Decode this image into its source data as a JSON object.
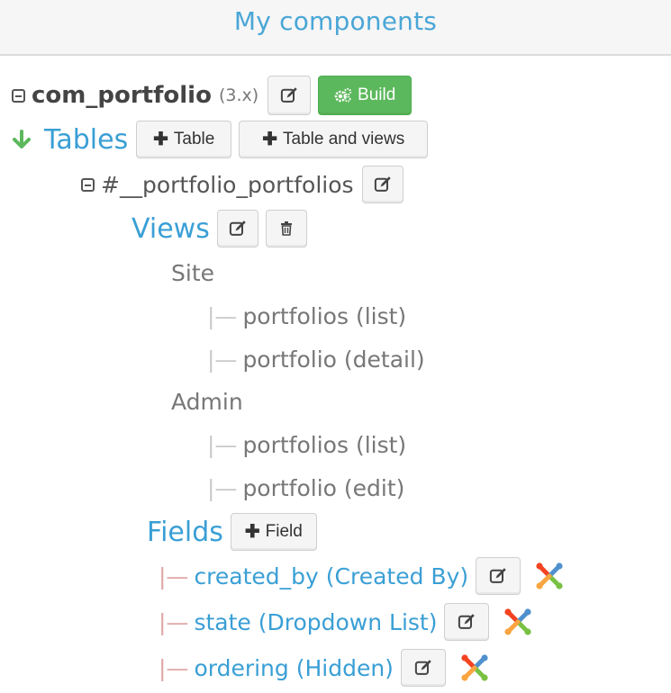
{
  "header": {
    "title": "My components"
  },
  "component": {
    "name": "com_portfolio",
    "version": "(3.x)",
    "build_label": "Build"
  },
  "tables": {
    "label": "Tables",
    "add_table_label": "Table",
    "add_table_views_label": "Table and views",
    "table_name": "#__portfolio_portfolios"
  },
  "views": {
    "label": "Views",
    "site_label": "Site",
    "site_items": [
      "portfolios (list)",
      "portfolio (detail)"
    ],
    "admin_label": "Admin",
    "admin_items": [
      "portfolios (list)",
      "portfolio (edit)"
    ]
  },
  "fields": {
    "label": "Fields",
    "add_field_label": "Field",
    "items": [
      "created_by (Created By)",
      "state (Dropdown List)",
      "ordering (Hidden)"
    ]
  },
  "icons": {
    "collapse": "collapse-square-icon",
    "edit": "edit-icon",
    "build": "gears-icon",
    "arrow": "arrow-down-icon",
    "trash": "trash-icon",
    "plus": "plus-icon",
    "joomla": "joomla-icon"
  },
  "colors": {
    "accent": "#3a9fd5",
    "build": "#5cb85c",
    "arrow": "#5cb85c"
  }
}
